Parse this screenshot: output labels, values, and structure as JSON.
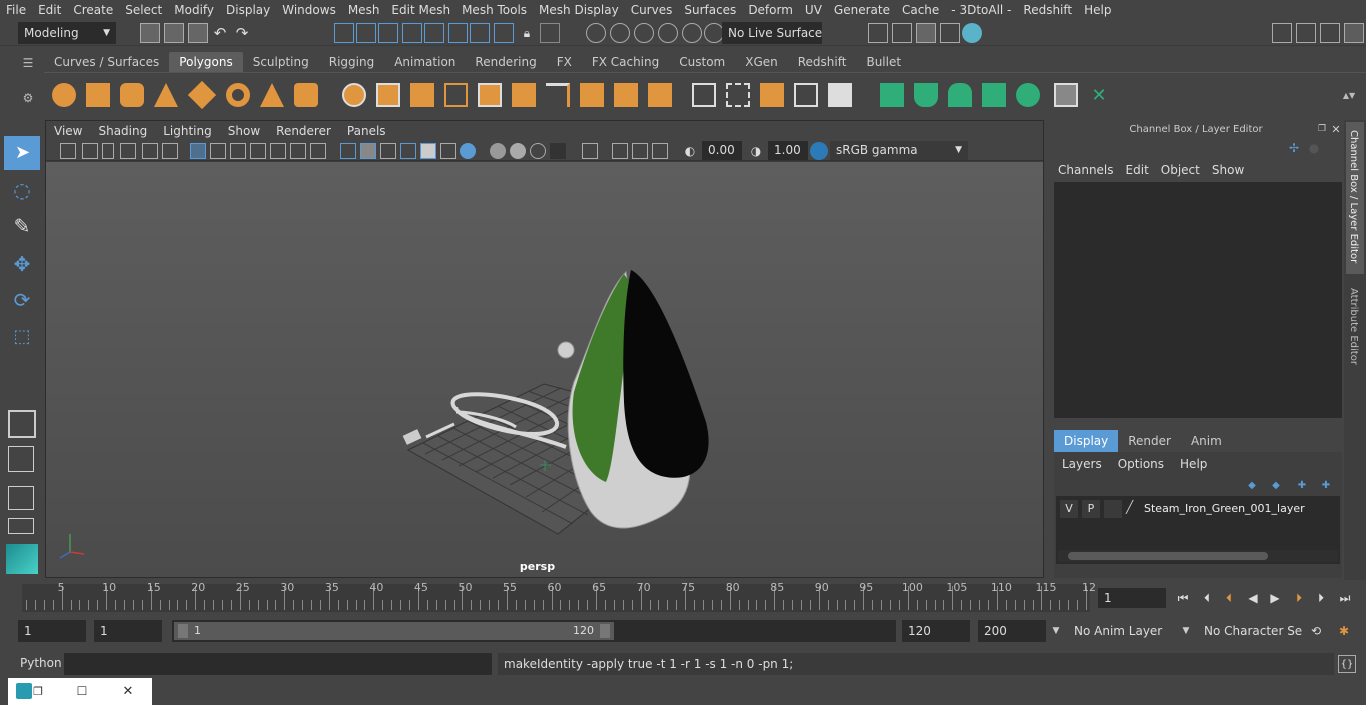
{
  "menubar": [
    "File",
    "Edit",
    "Create",
    "Select",
    "Modify",
    "Display",
    "Windows",
    "Mesh",
    "Edit Mesh",
    "Mesh Tools",
    "Mesh Display",
    "Curves",
    "Surfaces",
    "Deform",
    "UV",
    "Generate",
    "Cache",
    "- 3DtoAll -",
    "Redshift",
    "Help"
  ],
  "status": {
    "mode": "Modeling",
    "live_surface": "No Live Surface"
  },
  "shelf_tabs": [
    "Curves / Surfaces",
    "Polygons",
    "Sculpting",
    "Rigging",
    "Animation",
    "Rendering",
    "FX",
    "FX Caching",
    "Custom",
    "XGen",
    "Redshift",
    "Bullet"
  ],
  "shelf_active": "Polygons",
  "panel_menu": [
    "View",
    "Shading",
    "Lighting",
    "Show",
    "Renderer",
    "Panels"
  ],
  "panel_tools": {
    "exposure": "0.00",
    "gamma": "1.00",
    "colorspace": "sRGB gamma"
  },
  "viewport": {
    "camera_label": "persp"
  },
  "channel_box": {
    "title": "Channel Box / Layer Editor",
    "menu": [
      "Channels",
      "Edit",
      "Object",
      "Show"
    ]
  },
  "layer_editor": {
    "tabs": [
      "Display",
      "Render",
      "Anim"
    ],
    "active_tab": "Display",
    "menu": [
      "Layers",
      "Options",
      "Help"
    ],
    "layers": [
      {
        "v": "V",
        "p": "P",
        "name": "Steam_Iron_Green_001_layer"
      }
    ]
  },
  "side_tabs": [
    "Channel Box / Layer Editor",
    "Attribute Editor"
  ],
  "timeline": {
    "ticks": [
      "5",
      "10",
      "15",
      "20",
      "25",
      "30",
      "35",
      "40",
      "45",
      "50",
      "55",
      "60",
      "65",
      "70",
      "75",
      "80",
      "85",
      "90",
      "95",
      "100",
      "105",
      "110",
      "115",
      "12"
    ],
    "start_marker": "1",
    "current_frame": "1"
  },
  "range": {
    "start": "1",
    "playback_start": "1",
    "slider_start": "1",
    "slider_end": "120",
    "playback_end": "120",
    "end": "200",
    "anim_layer": "No Anim Layer",
    "character_set": "No Character Set"
  },
  "cmdline": {
    "label": "Python",
    "output": "makeIdentity -apply true -t 1 -r 1 -s 1 -n 0 -pn 1;"
  },
  "colors": {
    "accent_blue": "#5b9bd5",
    "shelf_orange": "#e0953f",
    "shelf_green": "#2fae7a",
    "iron_green": "#3f7a2a"
  }
}
